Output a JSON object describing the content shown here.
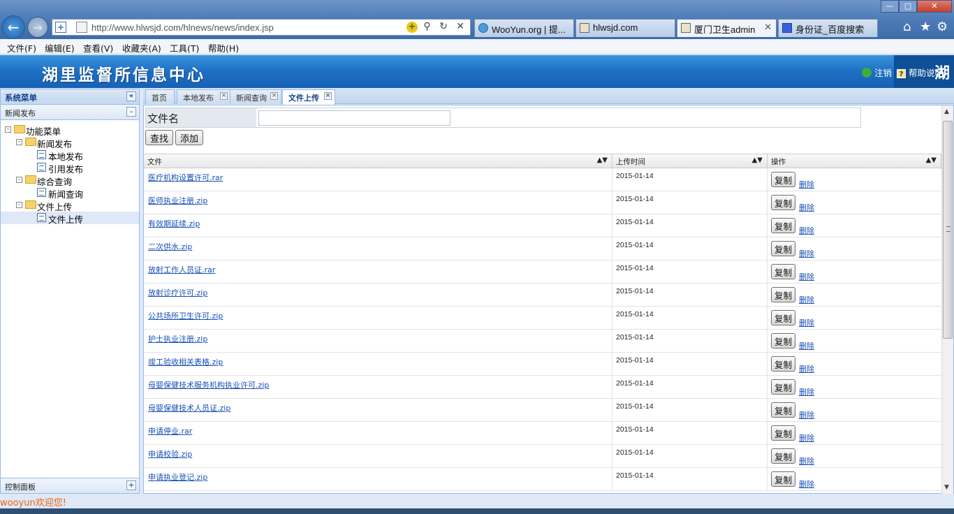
{
  "browser": {
    "url": "http://www.hlwsjd.com/hlnews/news/index.jsp",
    "tabs": [
      {
        "label": "WooYun.org | 提..."
      },
      {
        "label": "hlwsjd.com"
      },
      {
        "label": "厦门卫生admin"
      },
      {
        "label": "身份证_百度搜索"
      }
    ],
    "menu": [
      "文件(F)",
      "编辑(E)",
      "查看(V)",
      "收藏夹(A)",
      "工具(T)",
      "帮助(H)"
    ]
  },
  "header": {
    "title": "湖里监督所信息中心",
    "logout": "注销",
    "help": "帮助说明",
    "right_char": "湖"
  },
  "left": {
    "panel_title": "系统菜单",
    "section": "新闻发布",
    "footer": "控制面板",
    "tree": [
      {
        "label": "功能菜单"
      },
      {
        "label": "新闻发布"
      },
      {
        "label": "本地发布"
      },
      {
        "label": "引用发布"
      },
      {
        "label": "综合查询"
      },
      {
        "label": "新闻查询"
      },
      {
        "label": "文件上传"
      },
      {
        "label": "文件上传"
      }
    ]
  },
  "welcome": "wooyun欢迎您!",
  "content_tabs": [
    {
      "label": "首页"
    },
    {
      "label": "本地发布"
    },
    {
      "label": "新闻查询"
    },
    {
      "label": "文件上传"
    }
  ],
  "search": {
    "label": "文件名",
    "value": "",
    "find_label": "查找",
    "add_label": "添加"
  },
  "grid": {
    "columns": [
      "文件",
      "上传时间",
      "操作"
    ],
    "copy_label": "复制",
    "delete_label": "删除",
    "rows": [
      {
        "file": "医疗机构设置许可.rar",
        "date": "2015-01-14"
      },
      {
        "file": "医师执业注册.zip",
        "date": "2015-01-14"
      },
      {
        "file": "有效期延续.zip",
        "date": "2015-01-14"
      },
      {
        "file": "二次供水.zip",
        "date": "2015-01-14"
      },
      {
        "file": "放射工作人员证.rar",
        "date": "2015-01-14"
      },
      {
        "file": "放射诊疗许可.zip",
        "date": "2015-01-14"
      },
      {
        "file": "公共场所卫生许可.zip",
        "date": "2015-01-14"
      },
      {
        "file": "护士执业注册.zip",
        "date": "2015-01-14"
      },
      {
        "file": "竣工验收相关表格.zip",
        "date": "2015-01-14"
      },
      {
        "file": "母婴保健技术服务机构执业许可.zip",
        "date": "2015-01-14"
      },
      {
        "file": "母婴保健技术人员证.zip",
        "date": "2015-01-14"
      },
      {
        "file": "申请停业.rar",
        "date": "2015-01-14"
      },
      {
        "file": "申请校验.zip",
        "date": "2015-01-14"
      },
      {
        "file": "申请执业登记.zip",
        "date": "2015-01-14"
      }
    ]
  }
}
